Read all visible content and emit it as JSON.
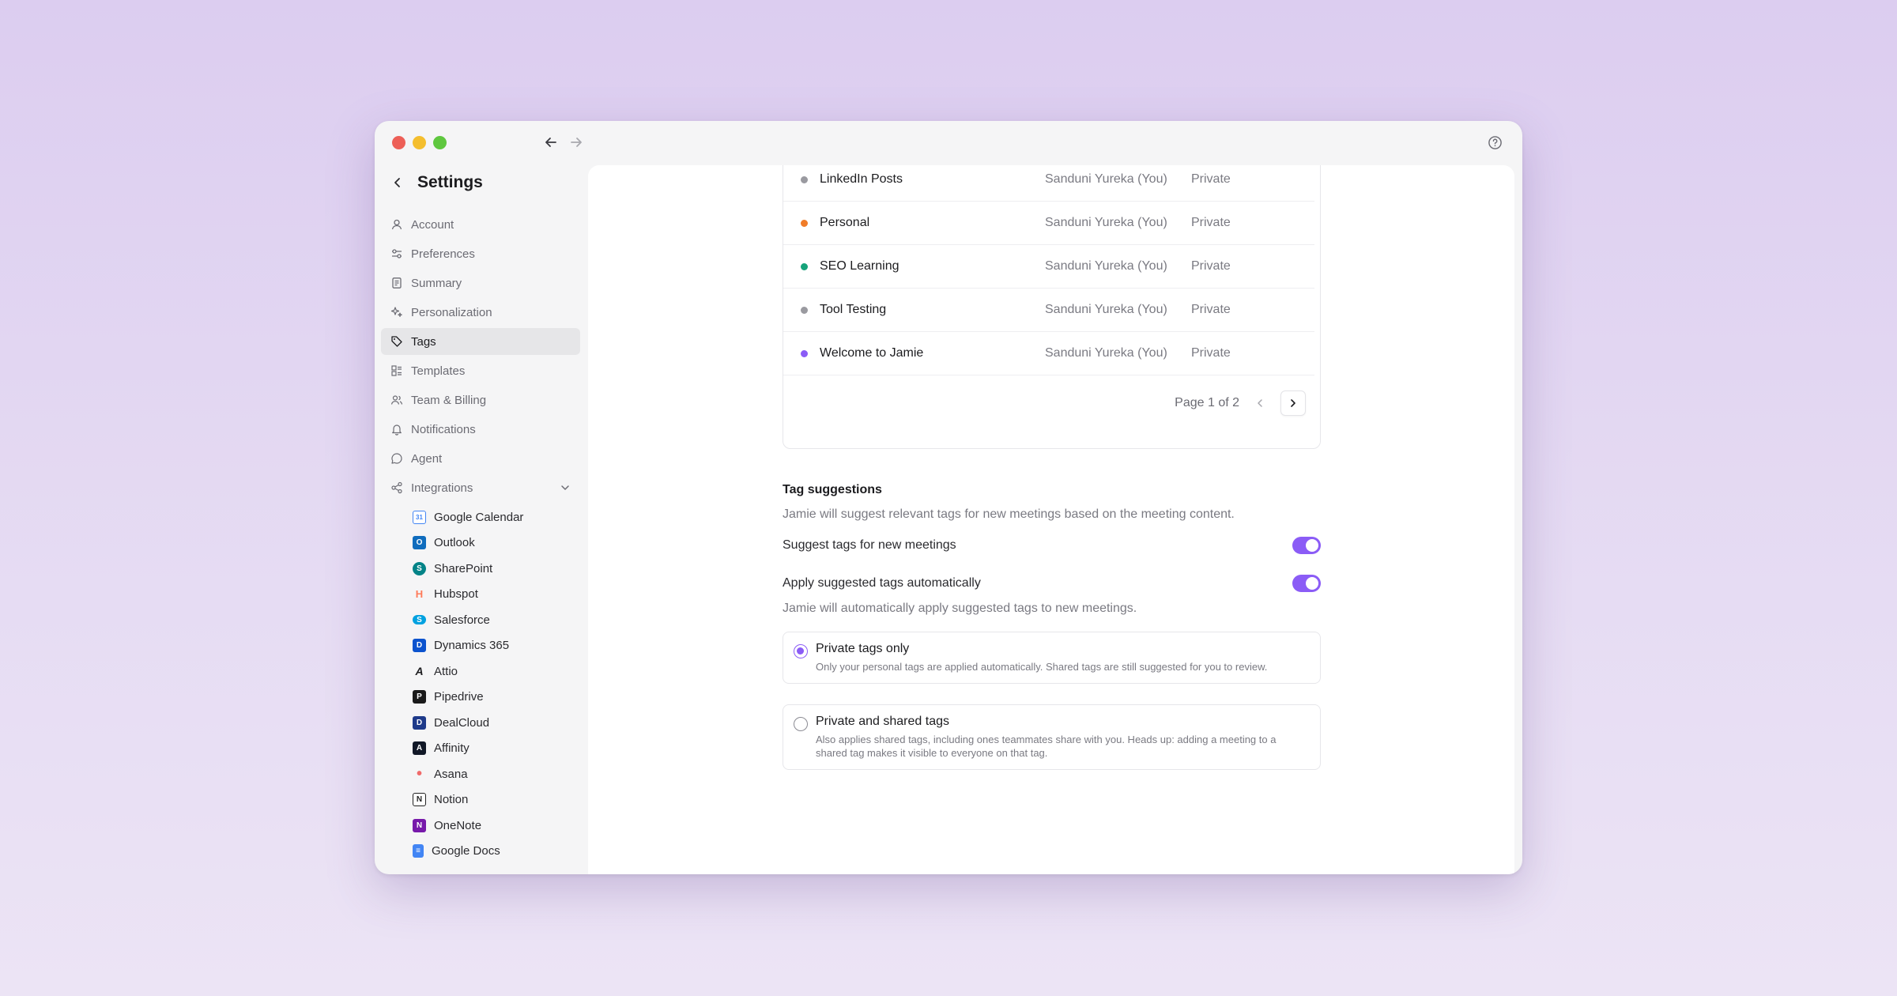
{
  "settings": {
    "title": "Settings"
  },
  "menu": [
    {
      "label": "Account",
      "icon": "user-icon"
    },
    {
      "label": "Preferences",
      "icon": "sliders-icon"
    },
    {
      "label": "Summary",
      "icon": "document-icon"
    },
    {
      "label": "Personalization",
      "icon": "sparkle-icon"
    },
    {
      "label": "Tags",
      "icon": "tag-icon",
      "active": true
    },
    {
      "label": "Templates",
      "icon": "template-icon"
    },
    {
      "label": "Team & Billing",
      "icon": "team-icon"
    },
    {
      "label": "Notifications",
      "icon": "bell-icon"
    },
    {
      "label": "Agent",
      "icon": "chat-icon"
    },
    {
      "label": "Integrations",
      "icon": "share-icon",
      "expanded": true
    }
  ],
  "integrations": [
    {
      "label": "Google Calendar",
      "color": "#4285f4",
      "glyph": "31"
    },
    {
      "label": "Outlook",
      "color": "#0f6cbd",
      "glyph": "O"
    },
    {
      "label": "SharePoint",
      "color": "#038387",
      "glyph": "S"
    },
    {
      "label": "Hubspot",
      "color": "#ff7a59",
      "glyph": "H"
    },
    {
      "label": "Salesforce",
      "color": "#00a1e0",
      "glyph": "S"
    },
    {
      "label": "Dynamics 365",
      "color": "#0b53ce",
      "glyph": "D"
    },
    {
      "label": "Attio",
      "color": "#1c1c1f",
      "glyph": "A"
    },
    {
      "label": "Pipedrive",
      "color": "#1a1a1a",
      "glyph": "P"
    },
    {
      "label": "DealCloud",
      "color": "#1e3a8a",
      "glyph": "D"
    },
    {
      "label": "Affinity",
      "color": "#111827",
      "glyph": "A"
    },
    {
      "label": "Asana",
      "color": "#f06a6a",
      "glyph": "•"
    },
    {
      "label": "Notion",
      "color": "#222222",
      "glyph": "N"
    },
    {
      "label": "OneNote",
      "color": "#7719aa",
      "glyph": "N"
    },
    {
      "label": "Google Docs",
      "color": "#4285f4",
      "glyph": "≡"
    }
  ],
  "tags": [
    {
      "name": "LinkedIn Posts",
      "owner": "Sanduni Yureka (You)",
      "visibility": "Private",
      "color": "#9a9aa0"
    },
    {
      "name": "Personal",
      "owner": "Sanduni Yureka (You)",
      "visibility": "Private",
      "color": "#f07c28"
    },
    {
      "name": "SEO Learning",
      "owner": "Sanduni Yureka (You)",
      "visibility": "Private",
      "color": "#16a37a"
    },
    {
      "name": "Tool Testing",
      "owner": "Sanduni Yureka (You)",
      "visibility": "Private",
      "color": "#9a9aa0"
    },
    {
      "name": "Welcome to Jamie",
      "owner": "Sanduni Yureka (You)",
      "visibility": "Private",
      "color": "#8b5cf6"
    }
  ],
  "pager": {
    "label": "Page 1 of 2"
  },
  "suggestions": {
    "title": "Tag suggestions",
    "description": "Jamie will suggest relevant tags for new meetings based on the meeting content.",
    "suggest_label": "Suggest tags for new meetings",
    "suggest_on": true,
    "apply_label": "Apply suggested tags automatically",
    "apply_on": true,
    "apply_description": "Jamie will automatically apply suggested tags to new meetings."
  },
  "options": [
    {
      "title": "Private tags only",
      "description": "Only your personal tags are applied automatically. Shared tags are still suggested for you to review.",
      "selected": true
    },
    {
      "title": "Private and shared tags",
      "description": "Also applies shared tags, including ones teammates share with you. Heads up: adding a meeting to a shared tag makes it visible to everyone on that tag.",
      "selected": false
    }
  ],
  "colors": {
    "accent": "#8b5cf6"
  }
}
